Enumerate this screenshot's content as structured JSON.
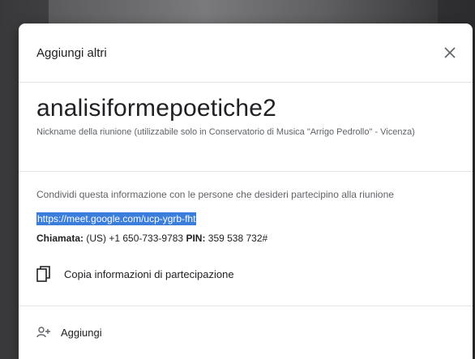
{
  "dialog": {
    "title": "Aggiungi altri",
    "close_icon": "close-icon"
  },
  "meeting": {
    "name": "analisiformepoetiche2",
    "nickname_note": "Nickname della riunione (utilizzabile solo in Conservatorio di Musica \"Arrigo Pedrollo\" - Vicenza)"
  },
  "share": {
    "instruction": "Condividi questa informazione con le persone che desideri partecipino alla riunione",
    "link": "https://meet.google.com/ucp-ygrb-fht",
    "call_label": "Chiamata:",
    "call_number": " (US) +1 650-733-9783 ",
    "pin_label": "PIN:",
    "pin_value": " 359 538 732#"
  },
  "actions": {
    "copy_label": "Copia informazioni di partecipazione",
    "copy_icon": "copy-icon",
    "add_label": "Aggiungi",
    "add_icon": "add-person-icon"
  },
  "colors": {
    "selection": "#3b7ddd",
    "text_primary": "#202124",
    "text_secondary": "#5f6368"
  }
}
